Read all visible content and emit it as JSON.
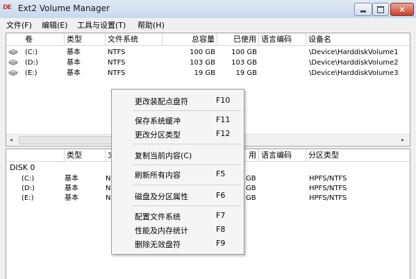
{
  "window": {
    "title": "Ext2 Volume Manager",
    "icon_text": "DE"
  },
  "menu": [
    {
      "label": "文件(F)"
    },
    {
      "label": "编辑(E)"
    },
    {
      "label": "工具与设置(T)"
    },
    {
      "label": "帮助(H)"
    }
  ],
  "volumes": {
    "headers": [
      "卷",
      "类型",
      "文件系统",
      "总容量",
      "已使用",
      "语言编码",
      "设备名"
    ],
    "rows": [
      {
        "vol": "(C:)",
        "type": "基本",
        "fs": "NTFS",
        "total": "100 GB",
        "used": "100 GB",
        "enc": "",
        "device": "\\Device\\HarddiskVolume1"
      },
      {
        "vol": "(D:)",
        "type": "基本",
        "fs": "NTFS",
        "total": "103 GB",
        "used": "103 GB",
        "enc": "",
        "device": "\\Device\\HarddiskVolume2"
      },
      {
        "vol": "(E:)",
        "type": "基本",
        "fs": "NTFS",
        "total": "19 GB",
        "used": "19 GB",
        "enc": "",
        "device": "\\Device\\HarddiskVolume3"
      }
    ]
  },
  "disks": {
    "headers": [
      "",
      "类型",
      "文",
      "用",
      "语言编码",
      "分区类型"
    ],
    "disk_label": "DISK 0",
    "rows": [
      {
        "vol": "(C:)",
        "type": "基本",
        "fs": "N",
        "used": "GB",
        "ptype": "HPFS/NTFS"
      },
      {
        "vol": "(D:)",
        "type": "基本",
        "fs": "N",
        "used": "GB",
        "ptype": "HPFS/NTFS"
      },
      {
        "vol": "(E:)",
        "type": "基本",
        "fs": "N",
        "used": "GB",
        "ptype": "HPFS/NTFS"
      }
    ]
  },
  "context_menu": {
    "items": [
      {
        "label": "更改装配点盘符",
        "key": "F10"
      },
      {
        "label": "保存系统缓冲",
        "key": "F11"
      },
      {
        "label": "更改分区类型",
        "key": "F12"
      },
      {
        "label": "复制当前内容(C)",
        "key": ""
      },
      {
        "label": "刷新所有内容",
        "key": "F5"
      },
      {
        "label": "磁盘及分区属性",
        "key": "F6"
      },
      {
        "label": "配置文件系统",
        "key": "F7"
      },
      {
        "label": "性能及内存统计",
        "key": "F8"
      },
      {
        "label": "删除无效盘符",
        "key": "F9"
      }
    ]
  },
  "scrollbar": {
    "left_arrow": "◂",
    "right_arrow": "▸"
  }
}
